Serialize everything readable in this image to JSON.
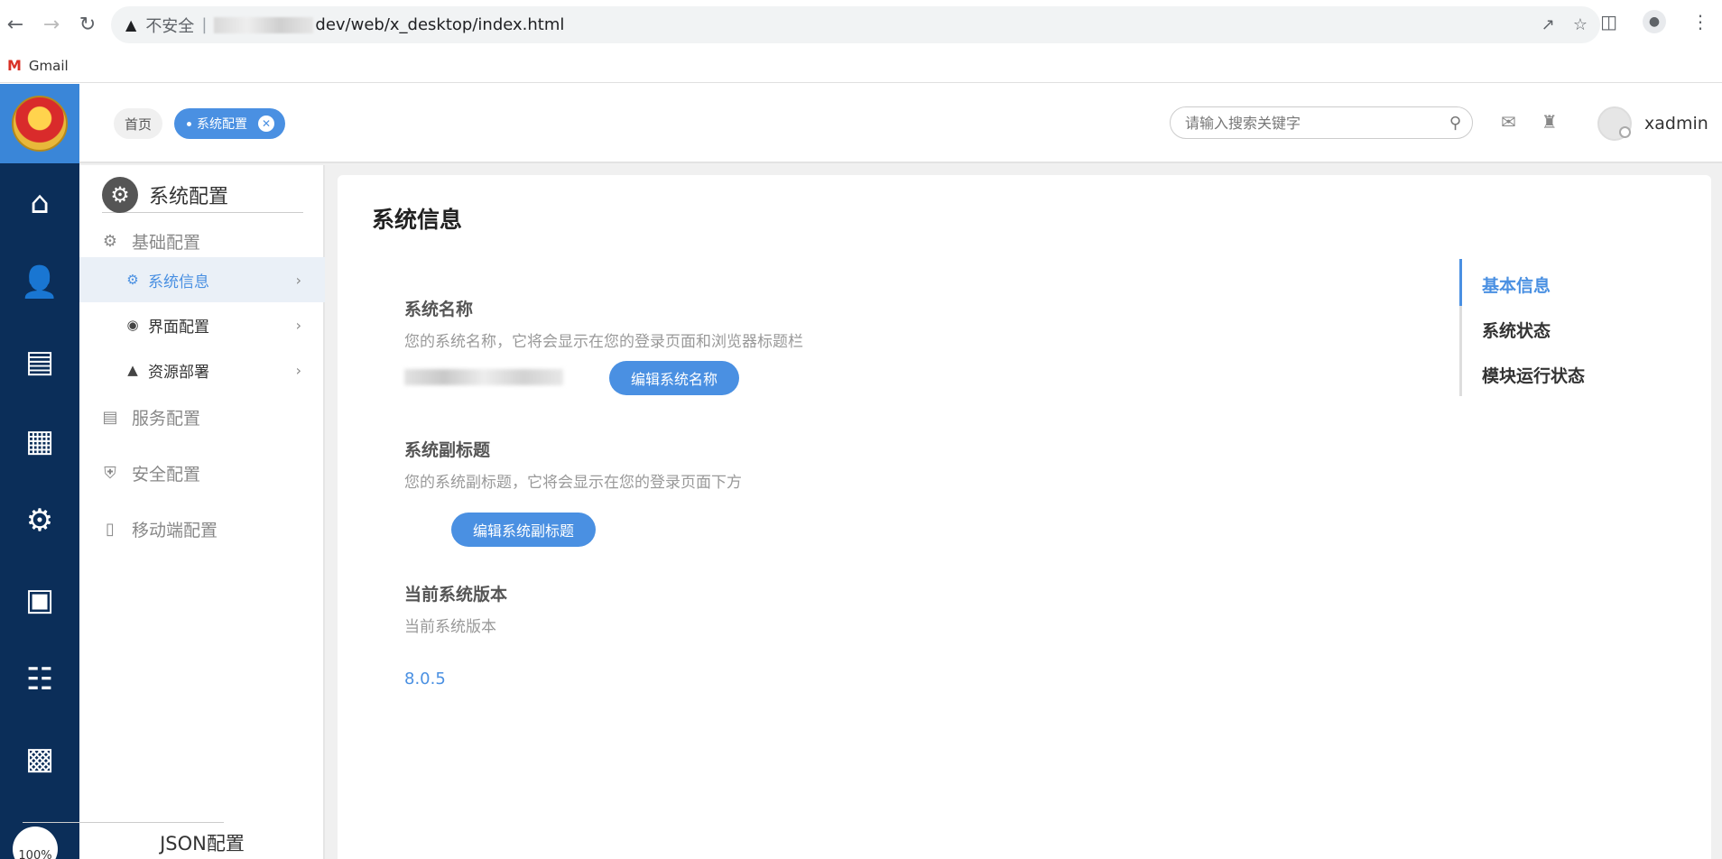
{
  "browser": {
    "security_label": "不安全",
    "url_visible": "dev/web/x_desktop/index.html",
    "bookmark_gmail": "Gmail"
  },
  "rail": {
    "zoom": "100%",
    "icons": [
      "home-icon",
      "monitor-user-icon",
      "news-icon",
      "calendar-icon",
      "user-settings-icon",
      "flow-monitor-icon",
      "org-chart-icon",
      "dashboard-icon"
    ]
  },
  "topbar": {
    "tab_home": "首页",
    "tab_active": "系统配置",
    "search_placeholder": "请输入搜索关键字",
    "username": "xadmin"
  },
  "sidemenu": {
    "title": "系统配置",
    "groups": {
      "basic": "基础配置",
      "service": "服务配置",
      "security": "安全配置",
      "mobile": "移动端配置"
    },
    "items": [
      {
        "label": "系统信息"
      },
      {
        "label": "界面配置"
      },
      {
        "label": "资源部署"
      }
    ],
    "footer": "JSON配置"
  },
  "content": {
    "title": "系统信息",
    "system_name": {
      "label": "系统名称",
      "desc": "您的系统名称，它将会显示在您的登录页面和浏览器标题栏",
      "button": "编辑系统名称"
    },
    "subtitle": {
      "label": "系统副标题",
      "desc": "您的系统副标题，它将会显示在您的登录页面下方",
      "button": "编辑系统副标题"
    },
    "version": {
      "label": "当前系统版本",
      "desc": "当前系统版本",
      "value": "8.0.5"
    },
    "anchors": [
      "基本信息",
      "系统状态",
      "模块运行状态"
    ]
  },
  "colors": {
    "accent": "#4a90e2",
    "rail_bg": "#0b2e59"
  }
}
